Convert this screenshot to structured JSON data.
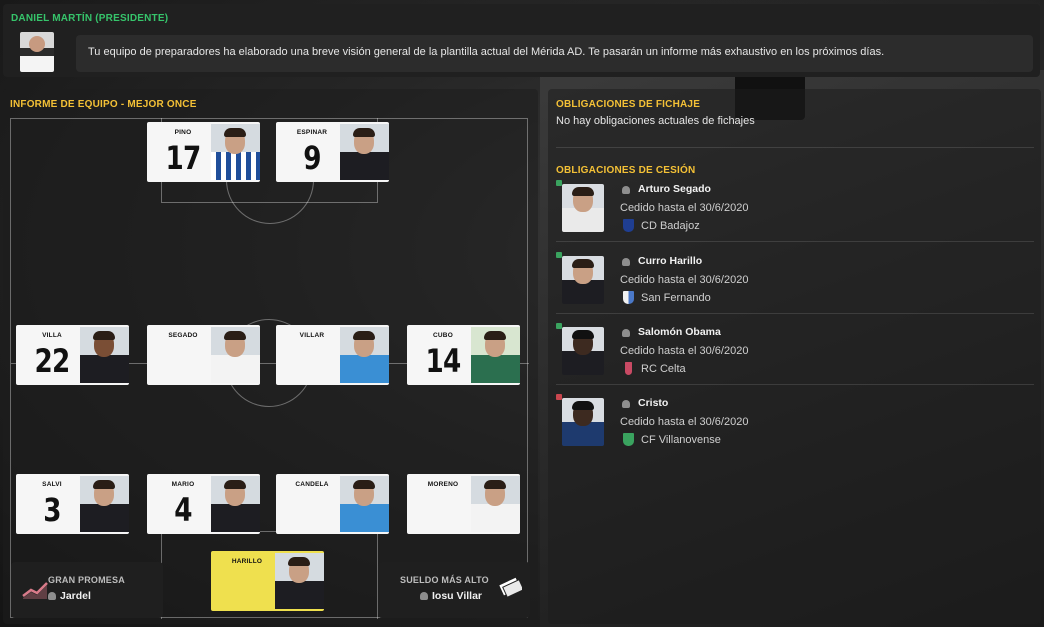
{
  "message": {
    "sender": "DANIEL MARTÍN (PRESIDENTE)",
    "text": "Tu equipo de preparadores ha elaborado una breve visión general de la plantilla actual del Mérida AD. Te pasarán un informe más exhaustivo en los próximos días."
  },
  "team_report": {
    "title": "INFORME DE EQUIPO - MEJOR ONCE",
    "players": {
      "pino": {
        "name": "PINO",
        "number": "17"
      },
      "espinar": {
        "name": "ESPINAR",
        "number": "9"
      },
      "villa": {
        "name": "VILLA",
        "number": "22"
      },
      "segado": {
        "name": "SEGADO",
        "number": ""
      },
      "villar": {
        "name": "VILLAR",
        "number": ""
      },
      "cubo": {
        "name": "CUBO",
        "number": "14"
      },
      "salvi": {
        "name": "SALVI",
        "number": "3"
      },
      "mario": {
        "name": "MARIO",
        "number": "4"
      },
      "candela": {
        "name": "CANDELA",
        "number": ""
      },
      "moreno": {
        "name": "MORENO",
        "number": ""
      },
      "harillo": {
        "name": "HARILLO",
        "number": ""
      }
    },
    "great_prospect": {
      "label": "GRAN PROMESA",
      "player": "Jardel"
    },
    "highest_wage": {
      "label": "SUELDO MÁS ALTO",
      "player": "Iosu Villar"
    }
  },
  "obligations": {
    "transfer_title": "OBLIGACIONES DE FICHAJE",
    "transfer_none": "No hay obligaciones actuales de fichajes",
    "loan_title": "OBLIGACIONES DE CESIÓN",
    "loans": [
      {
        "name": "Arturo Segado",
        "until": "Cedido hasta el 30/6/2020",
        "club": "CD Badajoz"
      },
      {
        "name": "Curro Harillo",
        "until": "Cedido hasta el 30/6/2020",
        "club": "San Fernando"
      },
      {
        "name": "Salomón Obama",
        "until": "Cedido hasta el 30/6/2020",
        "club": "RC Celta"
      },
      {
        "name": "Cristo",
        "until": "Cedido hasta el 30/6/2020",
        "club": "CF Villanovense"
      }
    ]
  },
  "colors": {
    "sender": "#36c46b",
    "section_title": "#f4c136",
    "goalkeeper_card": "#efe04e"
  },
  "icons": [
    "person-icon",
    "trend-icon",
    "money-icon",
    "club-crest-icon"
  ]
}
